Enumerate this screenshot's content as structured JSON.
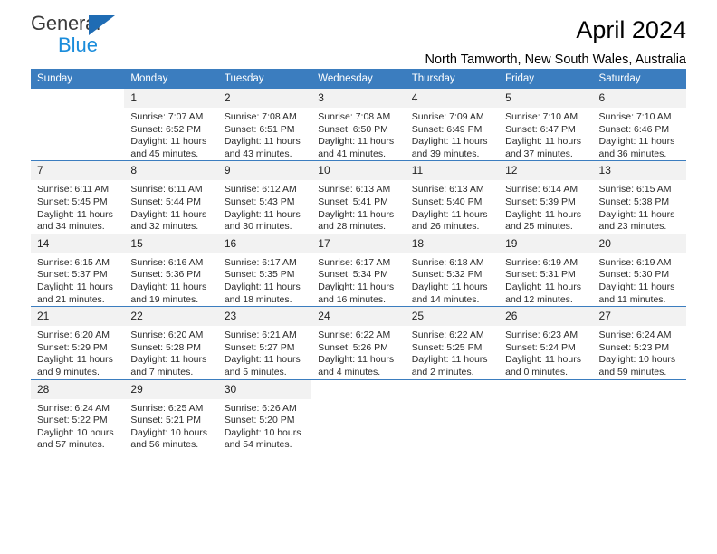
{
  "brand": {
    "name_part1": "General",
    "name_part2": "Blue"
  },
  "header": {
    "title": "April 2024",
    "subtitle": "North Tamworth, New South Wales, Australia"
  },
  "colors": {
    "header_blue": "#3b7dbf",
    "brand_blue": "#1a8cdb",
    "triangle_blue": "#1f6cb4",
    "daynum_band": "#f2f2f2"
  },
  "calendar": {
    "weekday_headers": [
      "Sunday",
      "Monday",
      "Tuesday",
      "Wednesday",
      "Thursday",
      "Friday",
      "Saturday"
    ],
    "labels": {
      "sunrise": "Sunrise:",
      "sunset": "Sunset:",
      "daylight": "Daylight:"
    },
    "weeks": [
      [
        {
          "day": "",
          "sunrise": "",
          "sunset": "",
          "daylight_line1": "",
          "daylight_line2": "",
          "blank": true
        },
        {
          "day": "1",
          "sunrise": "Sunrise: 7:07 AM",
          "sunset": "Sunset: 6:52 PM",
          "daylight_line1": "Daylight: 11 hours",
          "daylight_line2": "and 45 minutes."
        },
        {
          "day": "2",
          "sunrise": "Sunrise: 7:08 AM",
          "sunset": "Sunset: 6:51 PM",
          "daylight_line1": "Daylight: 11 hours",
          "daylight_line2": "and 43 minutes."
        },
        {
          "day": "3",
          "sunrise": "Sunrise: 7:08 AM",
          "sunset": "Sunset: 6:50 PM",
          "daylight_line1": "Daylight: 11 hours",
          "daylight_line2": "and 41 minutes."
        },
        {
          "day": "4",
          "sunrise": "Sunrise: 7:09 AM",
          "sunset": "Sunset: 6:49 PM",
          "daylight_line1": "Daylight: 11 hours",
          "daylight_line2": "and 39 minutes."
        },
        {
          "day": "5",
          "sunrise": "Sunrise: 7:10 AM",
          "sunset": "Sunset: 6:47 PM",
          "daylight_line1": "Daylight: 11 hours",
          "daylight_line2": "and 37 minutes."
        },
        {
          "day": "6",
          "sunrise": "Sunrise: 7:10 AM",
          "sunset": "Sunset: 6:46 PM",
          "daylight_line1": "Daylight: 11 hours",
          "daylight_line2": "and 36 minutes."
        }
      ],
      [
        {
          "day": "7",
          "sunrise": "Sunrise: 6:11 AM",
          "sunset": "Sunset: 5:45 PM",
          "daylight_line1": "Daylight: 11 hours",
          "daylight_line2": "and 34 minutes."
        },
        {
          "day": "8",
          "sunrise": "Sunrise: 6:11 AM",
          "sunset": "Sunset: 5:44 PM",
          "daylight_line1": "Daylight: 11 hours",
          "daylight_line2": "and 32 minutes."
        },
        {
          "day": "9",
          "sunrise": "Sunrise: 6:12 AM",
          "sunset": "Sunset: 5:43 PM",
          "daylight_line1": "Daylight: 11 hours",
          "daylight_line2": "and 30 minutes."
        },
        {
          "day": "10",
          "sunrise": "Sunrise: 6:13 AM",
          "sunset": "Sunset: 5:41 PM",
          "daylight_line1": "Daylight: 11 hours",
          "daylight_line2": "and 28 minutes."
        },
        {
          "day": "11",
          "sunrise": "Sunrise: 6:13 AM",
          "sunset": "Sunset: 5:40 PM",
          "daylight_line1": "Daylight: 11 hours",
          "daylight_line2": "and 26 minutes."
        },
        {
          "day": "12",
          "sunrise": "Sunrise: 6:14 AM",
          "sunset": "Sunset: 5:39 PM",
          "daylight_line1": "Daylight: 11 hours",
          "daylight_line2": "and 25 minutes."
        },
        {
          "day": "13",
          "sunrise": "Sunrise: 6:15 AM",
          "sunset": "Sunset: 5:38 PM",
          "daylight_line1": "Daylight: 11 hours",
          "daylight_line2": "and 23 minutes."
        }
      ],
      [
        {
          "day": "14",
          "sunrise": "Sunrise: 6:15 AM",
          "sunset": "Sunset: 5:37 PM",
          "daylight_line1": "Daylight: 11 hours",
          "daylight_line2": "and 21 minutes."
        },
        {
          "day": "15",
          "sunrise": "Sunrise: 6:16 AM",
          "sunset": "Sunset: 5:36 PM",
          "daylight_line1": "Daylight: 11 hours",
          "daylight_line2": "and 19 minutes."
        },
        {
          "day": "16",
          "sunrise": "Sunrise: 6:17 AM",
          "sunset": "Sunset: 5:35 PM",
          "daylight_line1": "Daylight: 11 hours",
          "daylight_line2": "and 18 minutes."
        },
        {
          "day": "17",
          "sunrise": "Sunrise: 6:17 AM",
          "sunset": "Sunset: 5:34 PM",
          "daylight_line1": "Daylight: 11 hours",
          "daylight_line2": "and 16 minutes."
        },
        {
          "day": "18",
          "sunrise": "Sunrise: 6:18 AM",
          "sunset": "Sunset: 5:32 PM",
          "daylight_line1": "Daylight: 11 hours",
          "daylight_line2": "and 14 minutes."
        },
        {
          "day": "19",
          "sunrise": "Sunrise: 6:19 AM",
          "sunset": "Sunset: 5:31 PM",
          "daylight_line1": "Daylight: 11 hours",
          "daylight_line2": "and 12 minutes."
        },
        {
          "day": "20",
          "sunrise": "Sunrise: 6:19 AM",
          "sunset": "Sunset: 5:30 PM",
          "daylight_line1": "Daylight: 11 hours",
          "daylight_line2": "and 11 minutes."
        }
      ],
      [
        {
          "day": "21",
          "sunrise": "Sunrise: 6:20 AM",
          "sunset": "Sunset: 5:29 PM",
          "daylight_line1": "Daylight: 11 hours",
          "daylight_line2": "and 9 minutes."
        },
        {
          "day": "22",
          "sunrise": "Sunrise: 6:20 AM",
          "sunset": "Sunset: 5:28 PM",
          "daylight_line1": "Daylight: 11 hours",
          "daylight_line2": "and 7 minutes."
        },
        {
          "day": "23",
          "sunrise": "Sunrise: 6:21 AM",
          "sunset": "Sunset: 5:27 PM",
          "daylight_line1": "Daylight: 11 hours",
          "daylight_line2": "and 5 minutes."
        },
        {
          "day": "24",
          "sunrise": "Sunrise: 6:22 AM",
          "sunset": "Sunset: 5:26 PM",
          "daylight_line1": "Daylight: 11 hours",
          "daylight_line2": "and 4 minutes."
        },
        {
          "day": "25",
          "sunrise": "Sunrise: 6:22 AM",
          "sunset": "Sunset: 5:25 PM",
          "daylight_line1": "Daylight: 11 hours",
          "daylight_line2": "and 2 minutes."
        },
        {
          "day": "26",
          "sunrise": "Sunrise: 6:23 AM",
          "sunset": "Sunset: 5:24 PM",
          "daylight_line1": "Daylight: 11 hours",
          "daylight_line2": "and 0 minutes."
        },
        {
          "day": "27",
          "sunrise": "Sunrise: 6:24 AM",
          "sunset": "Sunset: 5:23 PM",
          "daylight_line1": "Daylight: 10 hours",
          "daylight_line2": "and 59 minutes."
        }
      ],
      [
        {
          "day": "28",
          "sunrise": "Sunrise: 6:24 AM",
          "sunset": "Sunset: 5:22 PM",
          "daylight_line1": "Daylight: 10 hours",
          "daylight_line2": "and 57 minutes."
        },
        {
          "day": "29",
          "sunrise": "Sunrise: 6:25 AM",
          "sunset": "Sunset: 5:21 PM",
          "daylight_line1": "Daylight: 10 hours",
          "daylight_line2": "and 56 minutes."
        },
        {
          "day": "30",
          "sunrise": "Sunrise: 6:26 AM",
          "sunset": "Sunset: 5:20 PM",
          "daylight_line1": "Daylight: 10 hours",
          "daylight_line2": "and 54 minutes."
        },
        {
          "day": "",
          "sunrise": "",
          "sunset": "",
          "daylight_line1": "",
          "daylight_line2": "",
          "blank": true
        },
        {
          "day": "",
          "sunrise": "",
          "sunset": "",
          "daylight_line1": "",
          "daylight_line2": "",
          "blank": true
        },
        {
          "day": "",
          "sunrise": "",
          "sunset": "",
          "daylight_line1": "",
          "daylight_line2": "",
          "blank": true
        },
        {
          "day": "",
          "sunrise": "",
          "sunset": "",
          "daylight_line1": "",
          "daylight_line2": "",
          "blank": true
        }
      ]
    ]
  }
}
